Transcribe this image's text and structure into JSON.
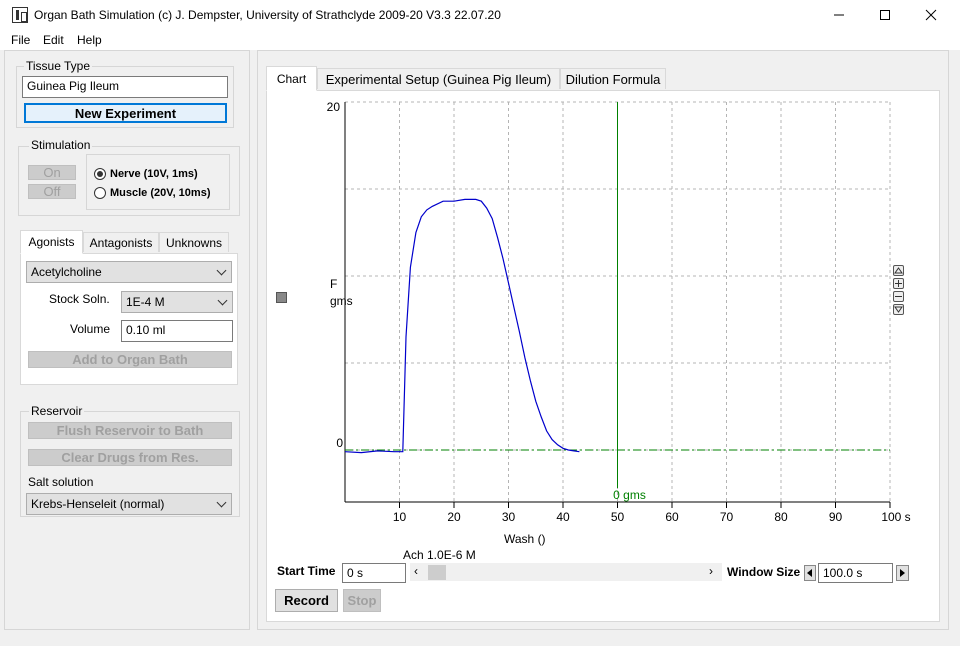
{
  "window": {
    "title": "Organ Bath Simulation (c) J. Dempster, University of Strathclyde 2009-20 V3.3 22.07.20",
    "controls": [
      "minimize",
      "maximize",
      "close"
    ]
  },
  "menu": {
    "items": [
      "File",
      "Edit",
      "Help"
    ]
  },
  "tissue": {
    "label": "Tissue Type",
    "value": "Guinea Pig Ileum",
    "new_experiment": "New Experiment"
  },
  "stimulation": {
    "label": "Stimulation",
    "on": "On",
    "off": "Off",
    "nerve": "Nerve (10V, 1ms)",
    "muscle": "Muscle (20V, 10ms)",
    "selected": "nerve"
  },
  "drug_tabs": {
    "agonists": "Agonists",
    "antagonists": "Antagonists",
    "unknowns": "Unknowns"
  },
  "agonist": {
    "drug": "Acetylcholine",
    "stock_label": "Stock Soln.",
    "stock_value": "1E-4 M",
    "volume_label": "Volume",
    "volume_value": "0.10 ml",
    "add_button": "Add to Organ Bath"
  },
  "reservoir": {
    "label": "Reservoir",
    "flush_button": "Flush Reservoir to Bath",
    "clear_button": "Clear Drugs from Res.",
    "salt_label": "Salt solution",
    "salt_value": "Krebs-Henseleit (normal)"
  },
  "main_tabs": {
    "chart": "Chart",
    "setup": "Experimental Setup (Guinea Pig Ileum)",
    "dilution": "Dilution Formula"
  },
  "chart_data": {
    "type": "line",
    "ylabel_top": "F",
    "ylabel_bottom": "gms",
    "y_top_label": "20",
    "y_bottom_label": "0",
    "ylim": [
      0,
      20
    ],
    "xlim": [
      0,
      100
    ],
    "x_ticks": [
      "10",
      "20",
      "30",
      "40",
      "50",
      "60",
      "70",
      "80",
      "90",
      "100 s"
    ],
    "xlabel": "Wash ()",
    "marker_label": "0 gms",
    "marker_x": 50,
    "event_label": "Ach 1.0E-6 M",
    "grid": true,
    "line_color": "#0000cc",
    "cursor_color": "#008000",
    "series": [
      {
        "x": [
          0,
          3,
          6,
          9,
          10.6,
          11.2,
          12,
          13,
          14,
          15,
          16,
          18,
          20,
          22,
          24,
          25,
          26,
          27,
          28,
          29,
          30,
          31,
          32,
          33,
          34,
          35,
          36,
          37,
          38,
          39,
          40,
          41,
          42,
          43
        ],
        "y": [
          -0.1,
          -0.15,
          -0.05,
          -0.1,
          -0.1,
          6.5,
          10.5,
          12.5,
          13.4,
          13.8,
          14.0,
          14.3,
          14.3,
          14.4,
          14.4,
          14.3,
          13.9,
          13.3,
          12.2,
          11.0,
          9.6,
          8.2,
          6.8,
          5.3,
          4.0,
          2.8,
          1.9,
          1.1,
          0.6,
          0.3,
          0.1,
          0.0,
          -0.05,
          -0.1
        ]
      }
    ]
  },
  "timebar": {
    "start_label": "Start Time",
    "start_value": "0 s",
    "window_label": "Window Size",
    "window_value": "100.0 s"
  },
  "actions": {
    "record": "Record",
    "stop": "Stop"
  }
}
